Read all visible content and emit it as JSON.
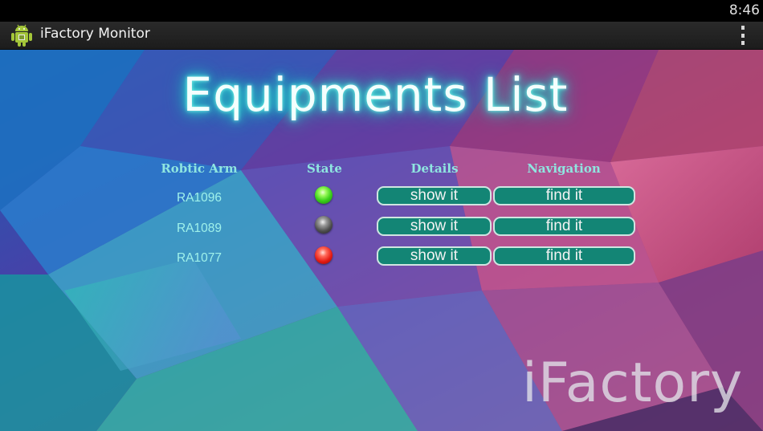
{
  "status_bar": {
    "time": "8:46"
  },
  "action_bar": {
    "title": "iFactory Monitor",
    "app_icon": "android-robot-icon",
    "overflow_icon": "overflow-menu-icon"
  },
  "main": {
    "title": "Equipments List",
    "columns": {
      "arm": "Robtic Arm",
      "state": "State",
      "details": "Details",
      "navigation": "Navigation"
    },
    "rows": [
      {
        "id": "RA1096",
        "state": "green",
        "details_label": "show it",
        "nav_label": "find it"
      },
      {
        "id": "RA1089",
        "state": "gray",
        "details_label": "show it",
        "nav_label": "find it"
      },
      {
        "id": "RA1077",
        "state": "red",
        "details_label": "show it",
        "nav_label": "find it"
      }
    ],
    "watermark": "iFactory"
  },
  "colors": {
    "button_bg": "#138575",
    "header_text": "#8fe6e0",
    "title_glow": "#35e6d8",
    "led_green": "#3bd11b",
    "led_gray": "#4e4e4e",
    "led_red": "#e41a12"
  }
}
